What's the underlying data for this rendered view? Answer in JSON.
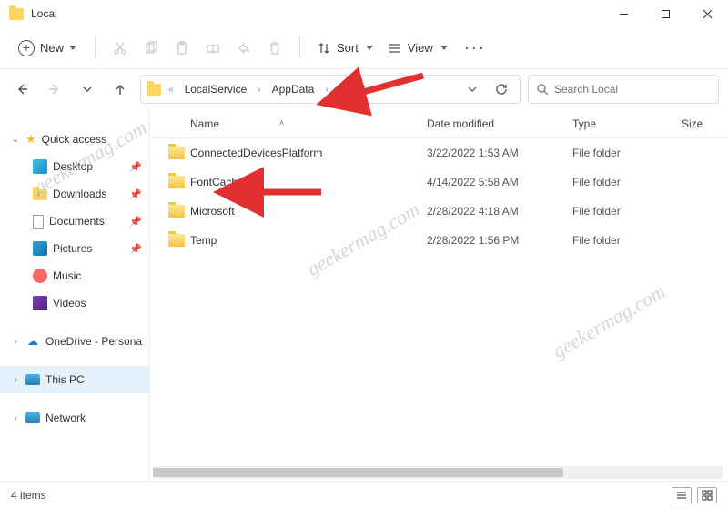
{
  "window": {
    "title": "Local"
  },
  "toolbar": {
    "new_label": "New",
    "sort_label": "Sort",
    "view_label": "View"
  },
  "breadcrumb": {
    "overflow": "«",
    "segments": [
      "LocalService",
      "AppData",
      "Local"
    ]
  },
  "search": {
    "placeholder": "Search Local"
  },
  "sidebar": {
    "quick_access": "Quick access",
    "items": [
      {
        "label": "Desktop"
      },
      {
        "label": "Downloads"
      },
      {
        "label": "Documents"
      },
      {
        "label": "Pictures"
      },
      {
        "label": "Music"
      },
      {
        "label": "Videos"
      }
    ],
    "onedrive": "OneDrive - Persona",
    "thispc": "This PC",
    "network": "Network"
  },
  "columns": {
    "name": "Name",
    "date": "Date modified",
    "type": "Type",
    "size": "Size"
  },
  "files": [
    {
      "name": "ConnectedDevicesPlatform",
      "date": "3/22/2022 1:53 AM",
      "type": "File folder"
    },
    {
      "name": "FontCache",
      "date": "4/14/2022 5:58 AM",
      "type": "File folder"
    },
    {
      "name": "Microsoft",
      "date": "2/28/2022 4:18 AM",
      "type": "File folder"
    },
    {
      "name": "Temp",
      "date": "2/28/2022 1:56 PM",
      "type": "File folder"
    }
  ],
  "status": {
    "count": "4 items"
  },
  "watermark": "geekermag.com"
}
